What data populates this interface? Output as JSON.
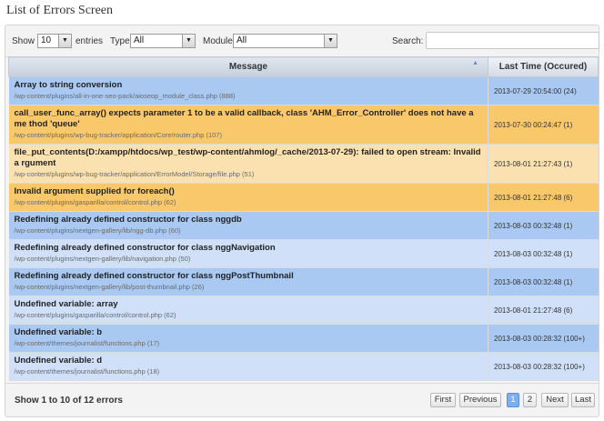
{
  "screen_title": "List of Errors Screen",
  "toolbar": {
    "show_label": "Show",
    "entries_value": "10",
    "entries_label": "entries",
    "type_label": "Type",
    "type_value": "All",
    "module_label": "Module",
    "module_value": "All",
    "search_label": "Search:",
    "search_value": ""
  },
  "table": {
    "columns": [
      "Message",
      "Last Time (Occured)"
    ],
    "rows": [
      {
        "title": "Array to string conversion",
        "path": "/wp-content/plugins/all-in-one-seo-pack/aioseop_module_class.php (888)",
        "time": "2013-07-29 20:54:00 (24)",
        "color": "blue"
      },
      {
        "title": "call_user_func_array() expects parameter 1 to be a valid callback, class 'AHM_Error_Controller' does not have a me thod 'queue'",
        "path": "/wp-content/plugins/wp-bug-tracker/application/Core/router.php (107)",
        "time": "2013-07-30 00:24:47 (1)",
        "color": "orange"
      },
      {
        "title": "file_put_contents(D:/xampp/htdocs/wp_test/wp-content/ahmlog/_cache/2013-07-29): failed to open stream: Invalid a rgument",
        "path": "/wp-content/plugins/wp-bug-tracker/application/ErrorModel/Storage/file.php (51)",
        "time": "2013-08-01 21:27:43 (1)",
        "color": "lorange"
      },
      {
        "title": "Invalid argument supplied for foreach()",
        "path": "/wp-content/plugins/gasparilla/control/control.php (62)",
        "time": "2013-08-01 21:27:48 (6)",
        "color": "orange"
      },
      {
        "title": "Redefining already defined constructor for class nggdb",
        "path": "/wp-content/plugins/nextgen-gallery/lib/ngg-db.php (60)",
        "time": "2013-08-03 00:32:48 (1)",
        "color": "blue"
      },
      {
        "title": "Redefining already defined constructor for class nggNavigation",
        "path": "/wp-content/plugins/nextgen-gallery/lib/navigation.php (50)",
        "time": "2013-08-03 00:32:48 (1)",
        "color": "lblue"
      },
      {
        "title": "Redefining already defined constructor for class nggPostThumbnail",
        "path": "/wp-content/plugins/nextgen-gallery/lib/post-thumbnail.php (26)",
        "time": "2013-08-03 00:32:48 (1)",
        "color": "blue"
      },
      {
        "title": "Undefined variable: array",
        "path": "/wp-content/plugins/gasparilla/control/control.php (62)",
        "time": "2013-08-01 21:27:48 (6)",
        "color": "lblue"
      },
      {
        "title": "Undefined variable: b",
        "path": "/wp-content/themes/journalist/functions.php (17)",
        "time": "2013-08-03 00:28:32 (100+)",
        "color": "blue"
      },
      {
        "title": "Undefined variable: d",
        "path": "/wp-content/themes/journalist/functions.php (18)",
        "time": "2013-08-03 00:28:32 (100+)",
        "color": "lblue"
      }
    ]
  },
  "footer": {
    "info": "Show 1 to 10 of 12 errors",
    "first": "First",
    "previous": "Previous",
    "page1": "1",
    "page2": "2",
    "next": "Next",
    "last": "Last"
  }
}
